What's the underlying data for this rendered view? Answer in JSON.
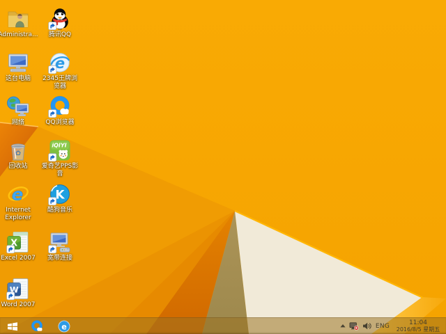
{
  "colors": {
    "wallpaper_main": "#F8A800",
    "wallpaper_wedge1": "#F09C03",
    "wallpaper_wedge2": "#EB9302",
    "wallpaper_wedge3": "#E78A00",
    "wallpaper_deep_top": "#E48200",
    "wallpaper_deep_bottom": "#D06800",
    "wallpaper_tan": "#A68F52",
    "wallpaper_cream": "#F1EAD8",
    "fold_edge_highlight": "#FFB606",
    "left_fold_highlight": "#FFC35C",
    "taskbar_tint": "rgba(153,114,32,0.52)",
    "tray_text": "#453e2c"
  },
  "desktop": {
    "icons": [
      {
        "name": "administrator-folder",
        "label": "Administra...",
        "icon": "folder-user",
        "shortcut": false,
        "col": 1,
        "row": 1
      },
      {
        "name": "tencent-qq",
        "label": "腾讯QQ",
        "icon": "qq-penguin",
        "shortcut": true,
        "col": 2,
        "row": 1
      },
      {
        "name": "this-pc",
        "label": "这台电脑",
        "icon": "computer",
        "shortcut": false,
        "col": 1,
        "row": 2
      },
      {
        "name": "browser-2345",
        "label": "2345王牌浏览器",
        "icon": "e-2345",
        "shortcut": true,
        "col": 2,
        "row": 2
      },
      {
        "name": "network",
        "label": "网络",
        "icon": "network-globe",
        "shortcut": false,
        "col": 1,
        "row": 3
      },
      {
        "name": "qq-browser",
        "label": "QQ浏览器",
        "icon": "qq-browser-ring",
        "shortcut": true,
        "col": 2,
        "row": 3
      },
      {
        "name": "recycle-bin",
        "label": "回收站",
        "icon": "recycle-bin",
        "shortcut": false,
        "col": 1,
        "row": 4
      },
      {
        "name": "iqiyi-pps",
        "label": "爱奇艺PPS影音",
        "icon": "iqiyi",
        "shortcut": true,
        "col": 2,
        "row": 4
      },
      {
        "name": "internet-explorer",
        "label": "Internet Explorer",
        "icon": "ie",
        "shortcut": false,
        "col": 1,
        "row": 5
      },
      {
        "name": "kugou-music",
        "label": "酷狗音乐",
        "icon": "kugou",
        "shortcut": true,
        "col": 2,
        "row": 5
      },
      {
        "name": "excel-2007",
        "label": "Excel 2007",
        "icon": "excel",
        "shortcut": true,
        "col": 1,
        "row": 6
      },
      {
        "name": "broadband",
        "label": "宽带连接",
        "icon": "broadband",
        "shortcut": true,
        "col": 2,
        "row": 6
      },
      {
        "name": "word-2007",
        "label": "Word 2007",
        "icon": "word",
        "shortcut": true,
        "col": 1,
        "row": 7
      }
    ]
  },
  "taskbar": {
    "pinned": [
      {
        "name": "taskbar-qq-browser",
        "icon": "qq-browser-ring"
      },
      {
        "name": "taskbar-2345-browser",
        "icon": "e-2345-task"
      }
    ],
    "tray": {
      "language": "ENG",
      "time": "11:04",
      "date": "2016/8/5 星期五"
    }
  }
}
